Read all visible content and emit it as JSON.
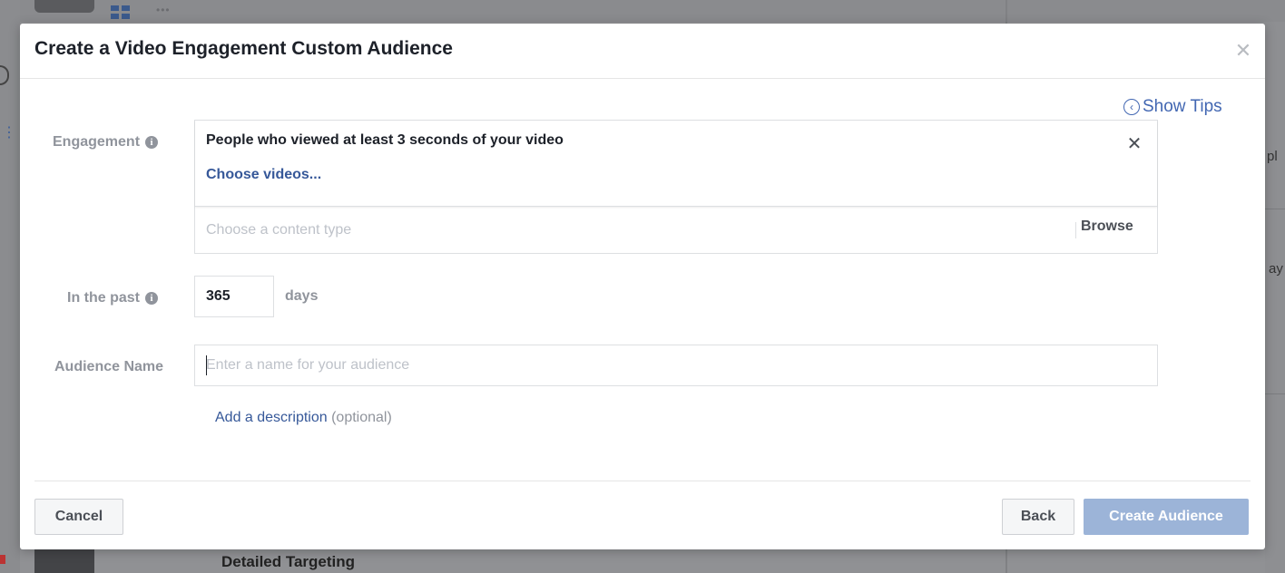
{
  "modal": {
    "title": "Create a Video Engagement Custom Audience",
    "close_icon": "close-icon",
    "show_tips": "Show Tips",
    "engagement": {
      "label": "Engagement",
      "selected_option": "People who viewed at least 3 seconds of your video",
      "choose_videos": "Choose videos...",
      "content_type_placeholder": "Choose a content type",
      "browse": "Browse"
    },
    "in_the_past": {
      "label": "In the past",
      "value": "365",
      "unit": "days"
    },
    "audience_name": {
      "label": "Audience Name",
      "placeholder": "Enter a name for your audience",
      "value": ""
    },
    "description": {
      "link": "Add a description",
      "optional": "(optional)"
    },
    "footer": {
      "cancel": "Cancel",
      "back": "Back",
      "create": "Create Audience"
    }
  },
  "background": {
    "detailed_targeting": "Detailed Targeting",
    "right_edge_1": "pl",
    "right_edge_2": "ay"
  },
  "colors": {
    "link": "#365899",
    "tips": "#4267b2",
    "create_disabled": "#9cb4d8",
    "label_gray": "#90949c"
  }
}
